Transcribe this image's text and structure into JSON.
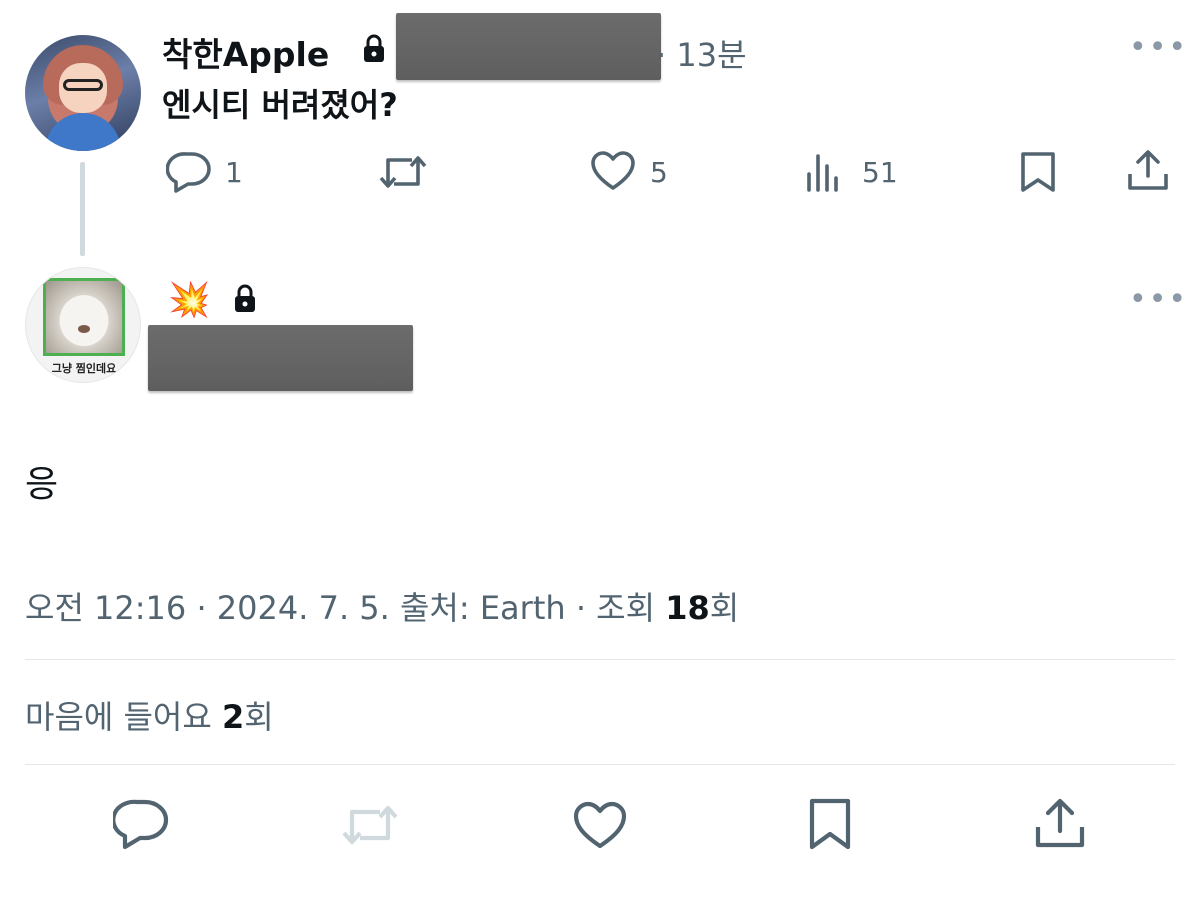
{
  "tweet_parent": {
    "display_name": "착한Apple",
    "time_ago": "13분",
    "text": "엔시티 버려졌어?",
    "actions": {
      "reply_count": "1",
      "like_count": "5",
      "views_count": "51"
    }
  },
  "tweet_main": {
    "avatar_caption": "그냥 찜인데요",
    "name_emoji": "💥",
    "text": "응",
    "meta": {
      "time": "오전 12:16",
      "date": "2024. 7. 5.",
      "source_label": "출처:",
      "source": "Earth",
      "views_label": "조회",
      "views_count": "18",
      "views_unit": "회"
    },
    "likes": {
      "label": "마음에 들어요",
      "count": "2",
      "unit": "회"
    }
  },
  "colors": {
    "text_primary": "#0f1419",
    "text_secondary": "#536471",
    "retweet_disabled": "#cfd9de",
    "divider": "#e4e8eb"
  },
  "icons": [
    "lock-icon",
    "more-icon",
    "reply-icon",
    "retweet-icon",
    "like-icon",
    "views-icon",
    "bookmark-icon",
    "share-icon"
  ]
}
